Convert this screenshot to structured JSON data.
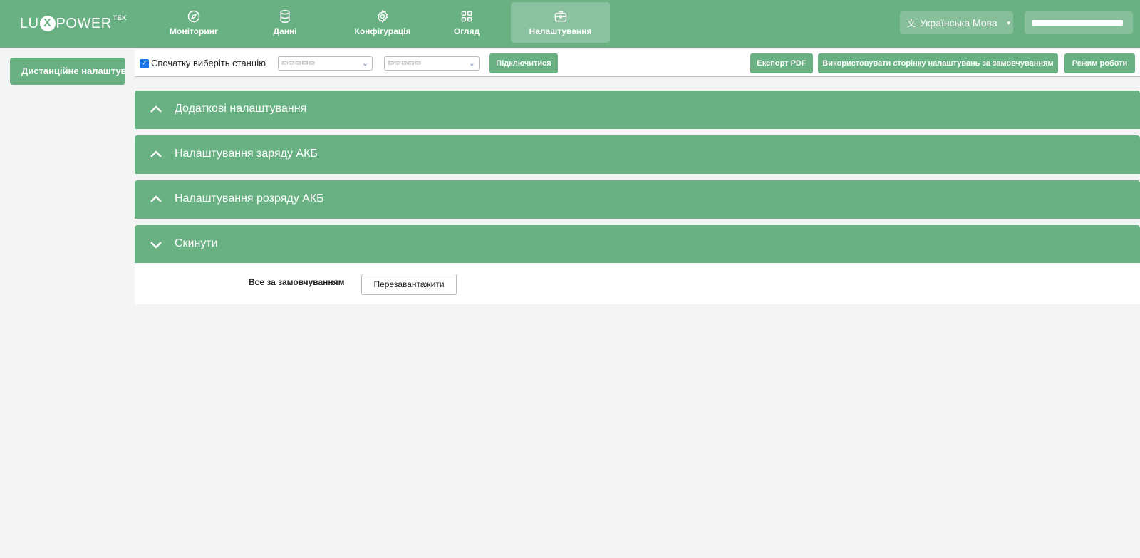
{
  "brand": {
    "logo_left": "LU",
    "logo_x": "X",
    "logo_right": "POWER",
    "logo_sup": "TEK"
  },
  "nav": {
    "items": [
      {
        "label": "Моніторинг",
        "icon": "compass-icon"
      },
      {
        "label": "Данні",
        "icon": "database-icon"
      },
      {
        "label": "Конфігурація",
        "icon": "gear-icon"
      },
      {
        "label": "Огляд",
        "icon": "grid-icon"
      },
      {
        "label": "Налаштування",
        "icon": "briefcase-icon",
        "active": true
      }
    ]
  },
  "header": {
    "language": "Українська Мова"
  },
  "sidebar": {
    "item_label": "Дистанційне налаштування"
  },
  "toolbar": {
    "checkbox_label": "Спочатку виберіть станцію",
    "checked": true,
    "connect_label": "Підключитися",
    "export_label": "Експорт PDF",
    "default_page_label": "Використовувати сторінку налаштувань за замовчуванням",
    "work_mode_label": "Режим роботи"
  },
  "sections": [
    {
      "title": "Додаткові налаштування",
      "expanded": false
    },
    {
      "title": "Налаштування заряду АКБ",
      "expanded": false
    },
    {
      "title": "Налаштування розряду АКБ",
      "expanded": false
    },
    {
      "title": "Скинути",
      "expanded": true
    }
  ],
  "reset_panel": {
    "label": "Все за замовчуванням",
    "button": "Перезавантажити"
  },
  "colors": {
    "accent": "#69b083",
    "background": "#f4f4f4",
    "checkbox": "#1a73e8"
  }
}
